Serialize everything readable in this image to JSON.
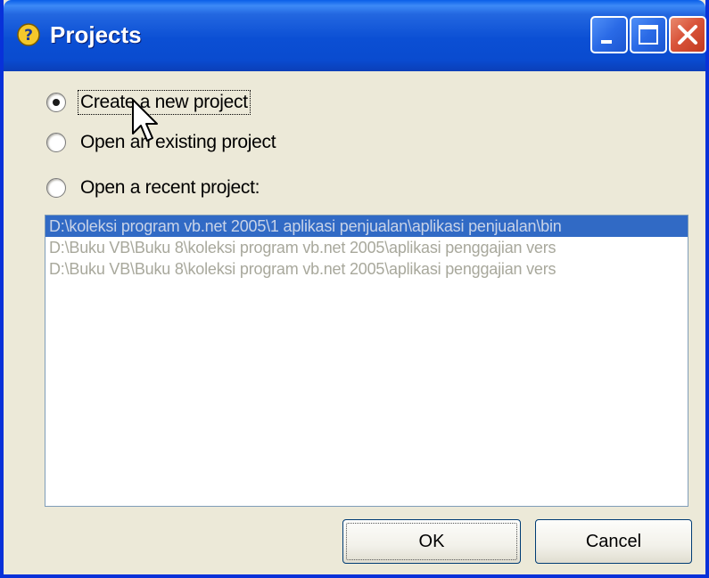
{
  "window": {
    "title": "Projects"
  },
  "options": [
    {
      "label": "Create a new project",
      "selected": true
    },
    {
      "label": "Open an existing project",
      "selected": false
    },
    {
      "label": "Open a recent project:",
      "selected": false
    }
  ],
  "recent_projects": [
    "D:\\koleksi program vb.net 2005\\1 aplikasi penjualan\\aplikasi penjualan\\bin",
    "D:\\Buku VB\\Buku 8\\koleksi program vb.net 2005\\aplikasi penggajian vers",
    "D:\\Buku VB\\Buku 8\\koleksi program vb.net 2005\\aplikasi penggajian vers"
  ],
  "buttons": {
    "ok": "OK",
    "cancel": "Cancel"
  },
  "icons": [
    "help-icon",
    "minimize-icon",
    "maximize-icon",
    "close-icon",
    "mouse-cursor-icon"
  ]
}
